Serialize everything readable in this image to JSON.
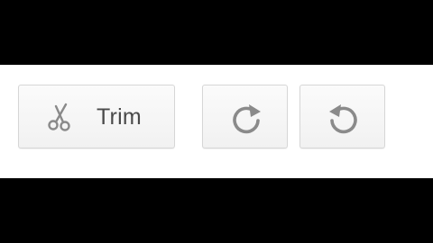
{
  "toolbar": {
    "trim": {
      "label": "Trim",
      "icon": "scissors-icon"
    },
    "rotate_clockwise": {
      "icon": "rotate-clockwise-icon"
    },
    "rotate_counterclockwise": {
      "icon": "rotate-counterclockwise-icon"
    }
  },
  "colors": {
    "icon": "#8a8a8a",
    "label": "#4a4a4a",
    "button_border": "#d6d6d6",
    "background": "#ffffff",
    "letterbox": "#000000"
  }
}
